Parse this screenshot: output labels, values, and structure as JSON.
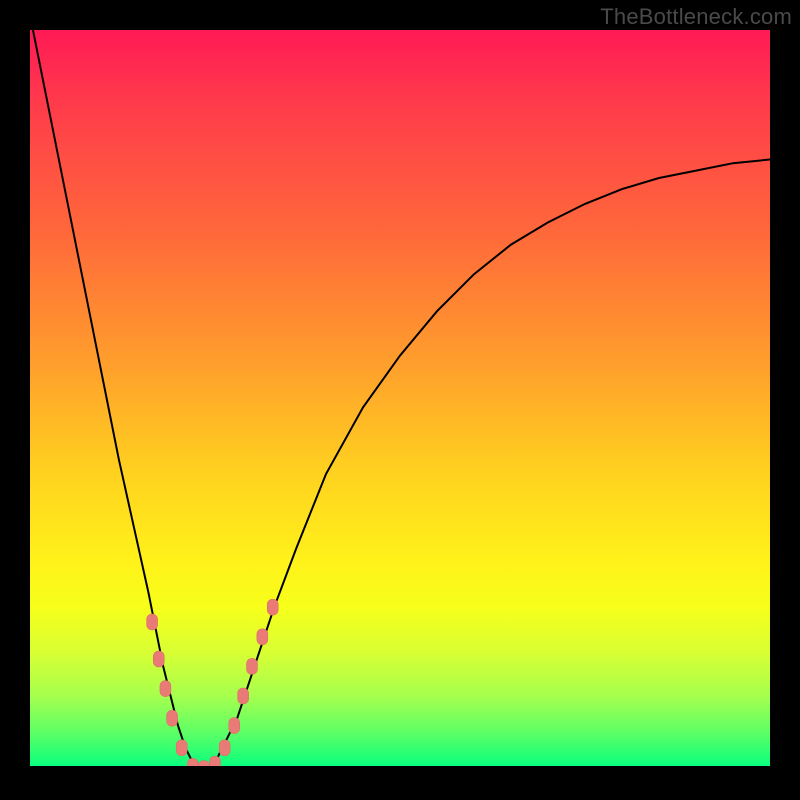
{
  "watermark": "TheBottleneck.com",
  "chart_data": {
    "type": "line",
    "title": "",
    "xlabel": "",
    "ylabel": "",
    "x_range": [
      0,
      100
    ],
    "y_range": [
      0,
      100
    ],
    "legend": false,
    "grid": false,
    "background": "red-yellow-green vertical gradient",
    "annotations": [
      "TheBottleneck.com"
    ],
    "series": [
      {
        "name": "bottleneck-curve",
        "color": "#000000",
        "x": [
          0,
          2,
          4,
          6,
          8,
          10,
          12,
          14,
          16,
          18,
          19,
          20,
          21,
          22,
          23,
          24,
          25,
          26,
          28,
          30,
          33,
          36,
          40,
          45,
          50,
          55,
          60,
          65,
          70,
          75,
          80,
          85,
          90,
          95,
          100
        ],
        "values": [
          102,
          92,
          82,
          72,
          62,
          52,
          42,
          33,
          24,
          14,
          10,
          6,
          3,
          1,
          0,
          0,
          1,
          3,
          7,
          13,
          22,
          30,
          40,
          49,
          56,
          62,
          67,
          71,
          74,
          76.5,
          78.5,
          80,
          81,
          82,
          82.5
        ]
      }
    ],
    "markers": {
      "name": "highlight-dots",
      "color": "#ea7a75",
      "shape": "rounded-rect",
      "points": [
        {
          "x": 16.5,
          "y": 20
        },
        {
          "x": 17.4,
          "y": 15
        },
        {
          "x": 18.3,
          "y": 11
        },
        {
          "x": 19.2,
          "y": 7
        },
        {
          "x": 20.5,
          "y": 3
        },
        {
          "x": 22.0,
          "y": 0.5
        },
        {
          "x": 23.5,
          "y": 0.2
        },
        {
          "x": 25.0,
          "y": 0.8
        },
        {
          "x": 26.3,
          "y": 3
        },
        {
          "x": 27.6,
          "y": 6
        },
        {
          "x": 28.8,
          "y": 10
        },
        {
          "x": 30.0,
          "y": 14
        },
        {
          "x": 31.4,
          "y": 18
        },
        {
          "x": 32.8,
          "y": 22
        }
      ]
    }
  }
}
